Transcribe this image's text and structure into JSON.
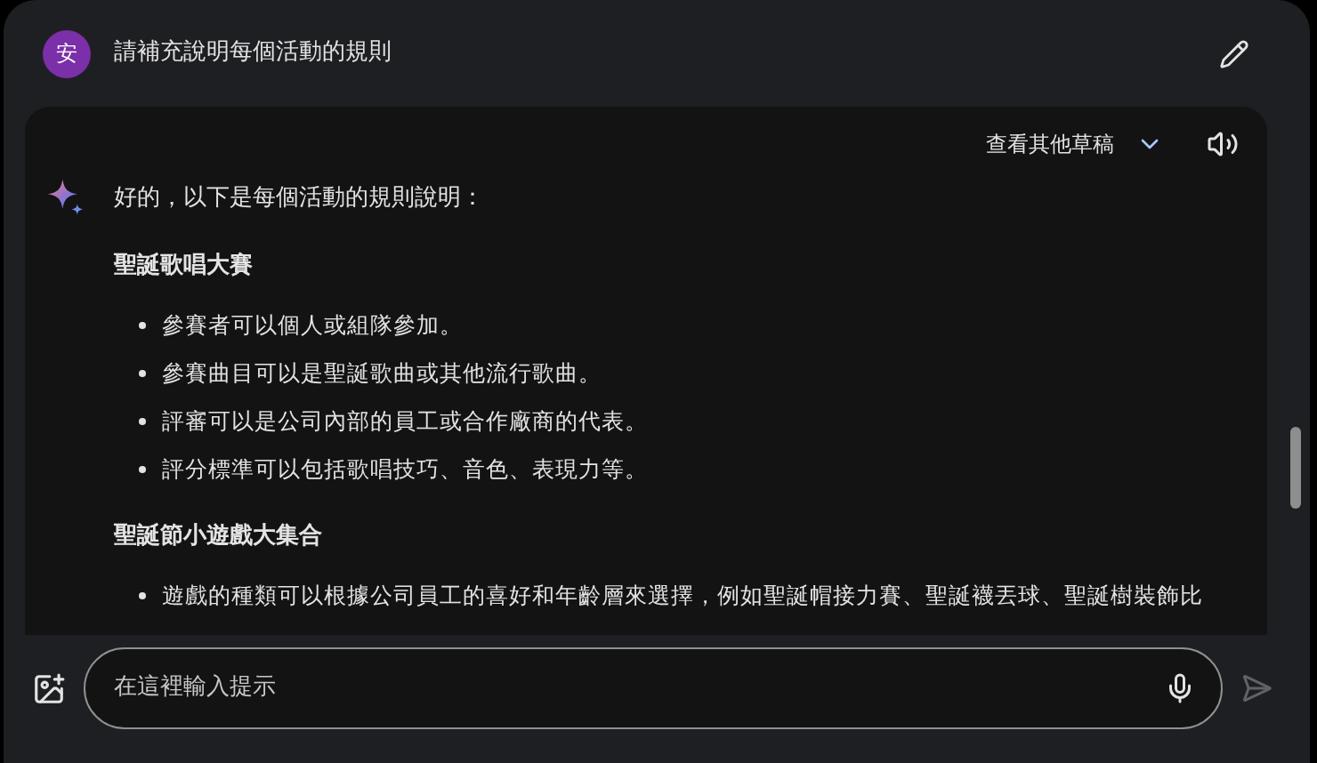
{
  "prompt": {
    "avatar": "安",
    "text": "請補充說明每個活動的規則"
  },
  "response": {
    "drafts_label": "查看其他草稿",
    "intro": "好的，以下是每個活動的規則說明：",
    "sections": [
      {
        "heading": "聖誕歌唱大賽",
        "bullets": [
          "參賽者可以個人或組隊參加。",
          "參賽曲目可以是聖誕歌曲或其他流行歌曲。",
          "評審可以是公司內部的員工或合作廠商的代表。",
          "評分標準可以包括歌唱技巧、音色、表現力等。"
        ]
      },
      {
        "heading": "聖誕節小遊戲大集合",
        "bullets": [
          "遊戲的種類可以根據公司員工的喜好和年齡層來選擇，例如聖誕帽接力賽、聖誕襪丟球、聖誕樹裝飾比"
        ]
      }
    ]
  },
  "input": {
    "placeholder": "在這裡輸入提示"
  }
}
